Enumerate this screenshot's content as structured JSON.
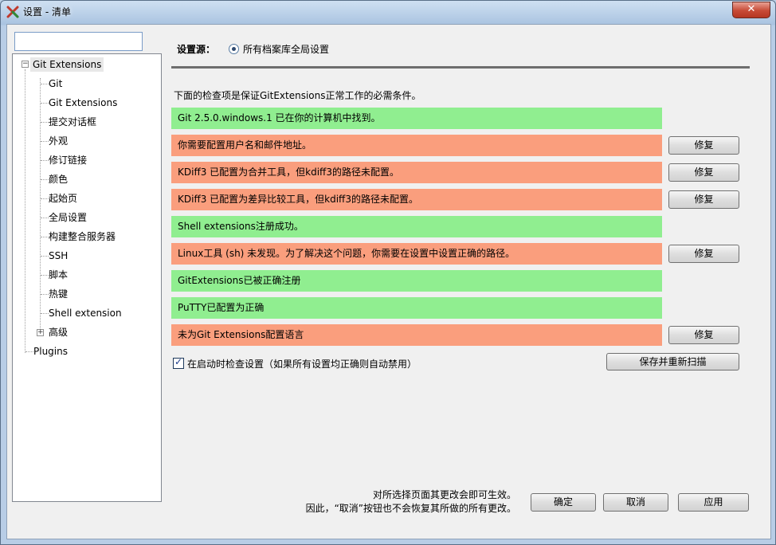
{
  "window": {
    "title": "设置 - 清单",
    "close_glyph": "✕"
  },
  "sidebar": {
    "search_value": "",
    "tree": [
      {
        "label": "Git Extensions",
        "expander": "−"
      },
      {
        "label": "Git"
      },
      {
        "label": "Git Extensions"
      },
      {
        "label": "提交对话框"
      },
      {
        "label": "外观"
      },
      {
        "label": "修订链接"
      },
      {
        "label": "颜色"
      },
      {
        "label": "起始页"
      },
      {
        "label": "全局设置"
      },
      {
        "label": "构建整合服务器"
      },
      {
        "label": "SSH"
      },
      {
        "label": "脚本"
      },
      {
        "label": "热键"
      },
      {
        "label": "Shell extension"
      },
      {
        "label": "高级",
        "expander": "+"
      },
      {
        "label": "Plugins"
      }
    ]
  },
  "main": {
    "source_label": "设置源：",
    "source_option": "所有档案库全局设置",
    "intro": "下面的检查项是保证GitExtensions正常工作的必需条件。",
    "checks": [
      {
        "text": "Git 2.5.0.windows.1 已在你的计算机中找到。",
        "status": "ok"
      },
      {
        "text": "你需要配置用户名和邮件地址。",
        "status": "bad",
        "button": "修复"
      },
      {
        "text": "KDiff3 已配置为合并工具，但kdiff3的路径未配置。",
        "status": "bad",
        "button": "修复"
      },
      {
        "text": "KDiff3 已配置为差异比较工具，但kdiff3的路径未配置。",
        "status": "bad",
        "button": "修复"
      },
      {
        "text": "Shell extensions注册成功。",
        "status": "ok"
      },
      {
        "text": "Linux工具 (sh) 未发现。为了解决这个问题，你需要在设置中设置正确的路径。",
        "status": "bad",
        "button": "修复"
      },
      {
        "text": "GitExtensions已被正确注册",
        "status": "ok"
      },
      {
        "text": "PuTTY已配置为正确",
        "status": "ok"
      },
      {
        "text": "未为Git Extensions配置语言",
        "status": "bad",
        "button": "修复"
      }
    ],
    "check_on_startup": {
      "label": "在启动时检查设置（如果所有设置均正确则自动禁用）",
      "checked": true
    },
    "rescan_button": "保存并重新扫描"
  },
  "footer": {
    "note_line1": "对所选择页面其更改会即可生效。",
    "note_line2": "因此，“取消”按钮也不会恢复其所做的所有更改。",
    "ok_button": "确定",
    "cancel_button": "取消",
    "apply_button": "应用"
  },
  "colors": {
    "ok": "#90ee90",
    "bad": "#fa9e7d"
  }
}
